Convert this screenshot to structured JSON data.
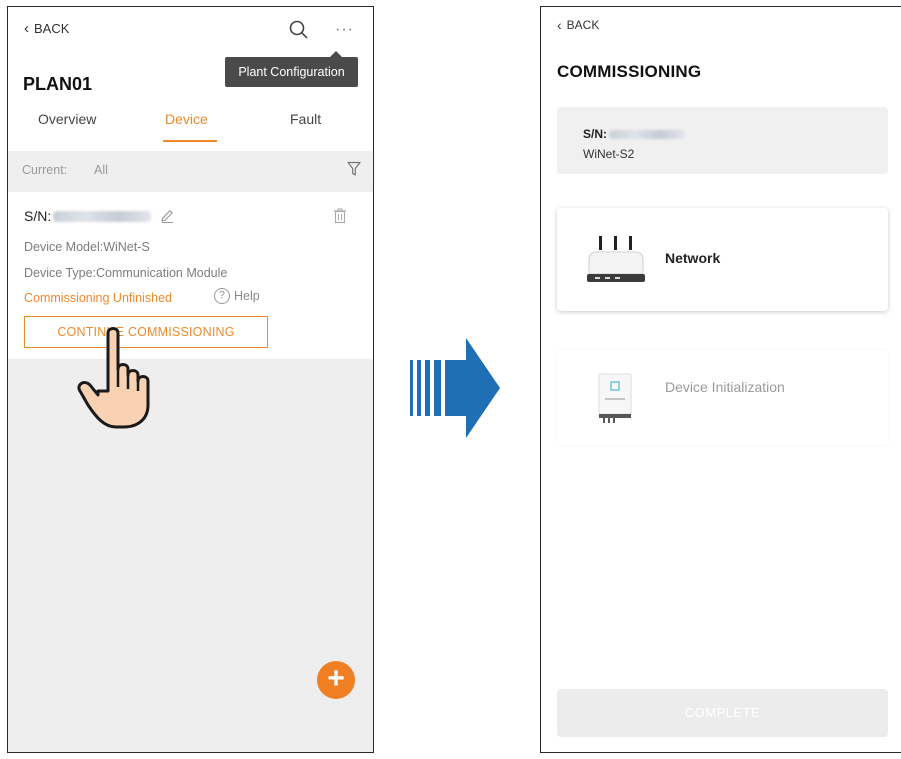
{
  "left_screen": {
    "back_label": "BACK",
    "more_label": "···",
    "tooltip": "Plant Configuration",
    "plant_name": "PLAN01",
    "tabs": [
      {
        "label": "Overview",
        "active": false
      },
      {
        "label": "Device",
        "active": true
      },
      {
        "label": "Fault",
        "active": false
      }
    ],
    "filter": {
      "current_label": "Current:",
      "current_value": "All"
    },
    "device": {
      "sn_label": "S/N:",
      "model_line": "Device Model:WiNet-S",
      "type_line": "Device Type:Communication Module",
      "status": "Commissioning Unfinished",
      "help_label": "Help",
      "continue_button": "CONTINUE COMMISSIONING"
    },
    "fab_label": "+"
  },
  "right_screen": {
    "back_label": "BACK",
    "title": "COMMISSIONING",
    "sn_label": "S/N:",
    "device_model": "WiNet-S2",
    "options": [
      {
        "label": "Network",
        "enabled": true
      },
      {
        "label": "Device Initialization",
        "enabled": false
      }
    ],
    "complete_button": "COMPLETE"
  },
  "colors": {
    "accent": "#ec8a2b",
    "fab": "#f07f23",
    "arrow": "#1f6fb5",
    "tooltip_bg": "#4a4a4a"
  },
  "icons": [
    "chevron-left-icon",
    "search-icon",
    "more-icon",
    "filter-icon",
    "edit-icon",
    "trash-icon",
    "help-icon",
    "pointing-hand-icon",
    "add-icon",
    "arrow-right-icon",
    "router-icon",
    "inverter-icon"
  ]
}
